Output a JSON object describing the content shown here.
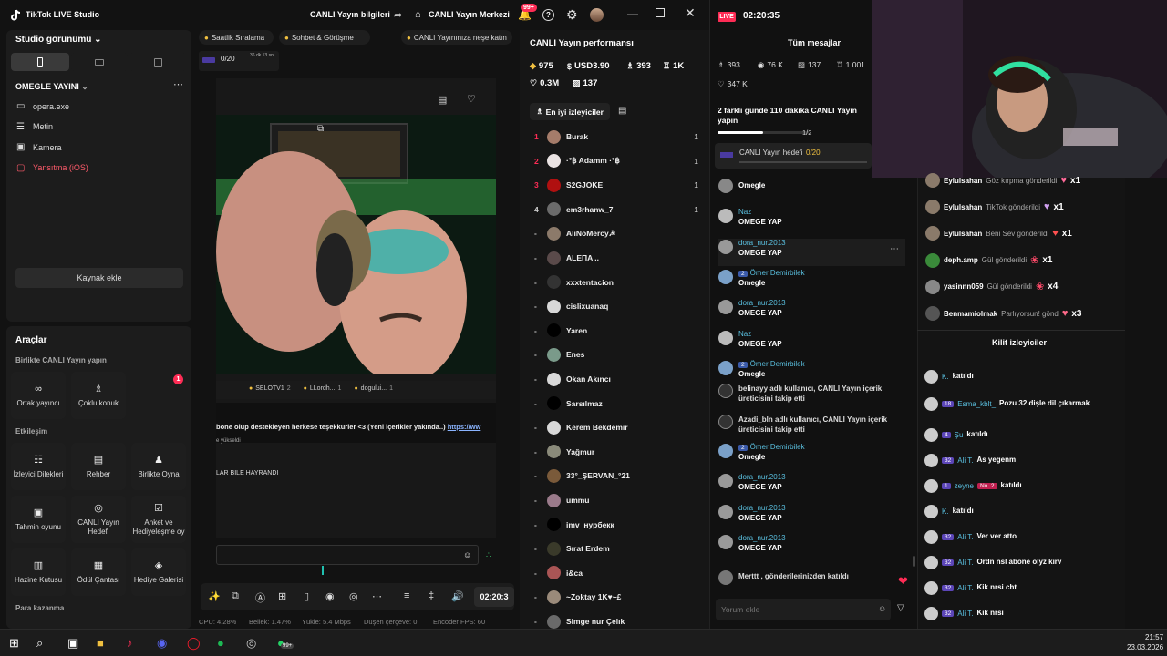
{
  "app": {
    "title": "TikTok LIVE Studio"
  },
  "titlebar": {
    "live_info": "CANLI Yayın bilgileri",
    "live_center": "CANLI Yayın Merkezi",
    "notif_badge": "99+"
  },
  "left": {
    "studio_view": "Studio görünümü",
    "scene_name": "OMEGLE YAYINI",
    "sources": [
      {
        "label": "opera.exe",
        "icon": "window-icon"
      },
      {
        "label": "Metin",
        "icon": "text-icon"
      },
      {
        "label": "Kamera",
        "icon": "camera-icon"
      },
      {
        "label": "Yansıtma (iOS)",
        "icon": "mirror-icon"
      }
    ],
    "add_source": "Kaynak ekle",
    "tools_title": "Araçlar",
    "section_together": "Birlikte CANLI Yayın yapın",
    "tools_together": [
      {
        "label": "Ortak yayıncı",
        "icon": "link-icon"
      },
      {
        "label": "Çoklu konuk",
        "icon": "users-icon",
        "badge": "1"
      }
    ],
    "section_engage": "Etkileşim",
    "tools_engage": [
      {
        "label": "İzleyici Dilekleri",
        "icon": "wish-icon"
      },
      {
        "label": "Rehber",
        "icon": "book-icon"
      },
      {
        "label": "Birlikte Oyna",
        "icon": "game-icon"
      },
      {
        "label": "Tahmin oyunu",
        "icon": "predict-icon"
      },
      {
        "label": "CANLI Yayın Hedefi",
        "icon": "target-icon"
      },
      {
        "label": "Anket ve Hediyeleşme oy",
        "icon": "poll-icon"
      },
      {
        "label": "Hazine Kutusu",
        "icon": "chest-icon"
      },
      {
        "label": "Ödül Çantası",
        "icon": "bag-icon"
      },
      {
        "label": "Hediye Galerisi",
        "icon": "gift-icon"
      }
    ],
    "section_money": "Para kazanma"
  },
  "center": {
    "pills": [
      "Saatlik Sıralama",
      "Sohbet & Görüşme",
      "CANLI Yayınınıza neşe katın"
    ],
    "goal_mini": "0/20",
    "goal_mini_time": "36 dk 13 sn",
    "banner_users": [
      {
        "name": "SELOTV1",
        "n": "2"
      },
      {
        "name": "LLordh...",
        "n": "1"
      },
      {
        "name": "dogului...",
        "n": "1"
      }
    ],
    "ticker_line1": "bone olup destekleyen herkese teşekkürler <3 (Yeni içerikler yakında..)",
    "ticker_link": "https://ww",
    "ticker_line2": "e yükseldi",
    "ticker_line3": "LAR BILE HAYRANDI",
    "timer": "02:20:3",
    "status": [
      {
        "label": "CPU:",
        "value": "4.28%"
      },
      {
        "label": "Bellek:",
        "value": "1.47%"
      },
      {
        "label": "Yükle:",
        "value": "5.4 Mbps"
      },
      {
        "label": "Düşen çerçeve:",
        "value": "0"
      },
      {
        "label": "Encoder FPS:",
        "value": "60"
      }
    ]
  },
  "perf": {
    "title": "CANLI Yayın performansı",
    "stats": [
      {
        "icon": "coin-icon",
        "value": "975"
      },
      {
        "icon": "dollar-icon",
        "value": "USD3.90"
      },
      {
        "icon": "viewers-icon",
        "value": "393"
      },
      {
        "icon": "follow-icon",
        "value": "1K"
      },
      {
        "icon": "heart-icon",
        "value": "0.3M"
      },
      {
        "icon": "gift-icon",
        "value": "137"
      }
    ],
    "tab_label": "En iyi izleyiciler",
    "viewers": [
      {
        "rank": "1",
        "name": "Burak",
        "count": "1",
        "color": "#a57c6a"
      },
      {
        "rank": "2",
        "name": "·°฿ Adamm ·°฿",
        "count": "1",
        "color": "#e9e2e2"
      },
      {
        "rank": "3",
        "name": "S2GJOKE",
        "count": "1",
        "color": "#b01010"
      },
      {
        "rank": "4",
        "name": "em3rhanw_7",
        "count": "1",
        "color": "#6b6b6b"
      },
      {
        "rank": "-",
        "name": "AliNoMercy☭",
        "count": "",
        "color": "#8c7a6a"
      },
      {
        "rank": "-",
        "name": "ALEПA ..",
        "count": "",
        "color": "#5a4a4a"
      },
      {
        "rank": "-",
        "name": "xxxtentacion",
        "count": "",
        "color": "#333"
      },
      {
        "rank": "-",
        "name": "cislixuanaq",
        "count": "",
        "color": "#d8d8d8"
      },
      {
        "rank": "-",
        "name": "Yaren",
        "count": "",
        "color": "#000"
      },
      {
        "rank": "-",
        "name": "Enes",
        "count": "",
        "color": "#7a9a8a"
      },
      {
        "rank": "-",
        "name": "Okan Akıncı",
        "count": "",
        "color": "#d8d8d8"
      },
      {
        "rank": "-",
        "name": "Sarsılmaz",
        "count": "",
        "color": "#000"
      },
      {
        "rank": "-",
        "name": "Kerem Bekdemir",
        "count": "",
        "color": "#d8d8d8"
      },
      {
        "rank": "-",
        "name": "Yağmur",
        "count": "",
        "color": "#8a8a7a"
      },
      {
        "rank": "-",
        "name": "33°_ŞERVAN_°21",
        "count": "",
        "color": "#7a5a3a"
      },
      {
        "rank": "-",
        "name": "ummu",
        "count": "",
        "color": "#9a7a8a"
      },
      {
        "rank": "-",
        "name": "imv_нурбекк",
        "count": "",
        "color": "#000"
      },
      {
        "rank": "-",
        "name": "Sırat Erdem",
        "count": "",
        "color": "#3a3a2a"
      },
      {
        "rank": "-",
        "name": "i&ca",
        "count": "",
        "color": "#aa5555"
      },
      {
        "rank": "-",
        "name": "~Zoktay 1K♥~£",
        "count": "",
        "color": "#9a8a7a"
      },
      {
        "rank": "-",
        "name": "Simge nur Çelık",
        "count": "",
        "color": "#6a6a6a"
      }
    ]
  },
  "chat": {
    "live": "LIVE",
    "time": "02:20:35",
    "all_messages": "Tüm mesajlar",
    "stats": [
      {
        "icon": "viewers-icon",
        "value": "393"
      },
      {
        "icon": "eye-icon",
        "value": "76 K"
      },
      {
        "icon": "gift-icon",
        "value": "137"
      },
      {
        "icon": "follow-icon",
        "value": "1.001"
      },
      {
        "icon": "heart-icon",
        "value": "347 K"
      }
    ],
    "mission": "2 farklı günde 110 dakika CANLI Yayın yapın",
    "mission_progress": "1/2",
    "mission_fraction": 0.5,
    "goal_label": "CANLI Yayın hedefi",
    "goal_value": "0/20",
    "messages": [
      {
        "name": "",
        "text": "Omegle",
        "lvl": "",
        "color": "#888"
      },
      {
        "name": "Naz",
        "text": "OMEGE YAP",
        "lvl": "",
        "color": "#bbb"
      },
      {
        "name": "dora_nur.2013",
        "text": "OMEGE YAP",
        "lvl": "",
        "color": "#999",
        "highlight": true
      },
      {
        "name": "Ömer Demirbilek",
        "text": "Omegle",
        "lvl": "2",
        "color": "#7aa0c8"
      },
      {
        "name": "dora_nur.2013",
        "text": "OMEGE YAP",
        "lvl": "",
        "color": "#999"
      },
      {
        "name": "Naz",
        "text": "OMEGE YAP",
        "lvl": "",
        "color": "#bbb"
      },
      {
        "name": "Ömer Demirbilek",
        "text": "Omegle",
        "lvl": "2",
        "color": "#7aa0c8"
      }
    ],
    "follow_events": [
      {
        "text": "belinayy  adlı kullanıcı, CANLI Yayın içerik üreticisini takip etti"
      },
      {
        "text": "Azadi_bln  adlı kullanıcı, CANLI Yayın içerik üreticisini takip etti"
      }
    ],
    "messages2": [
      {
        "name": "Ömer Demirbilek",
        "text": "Omegle",
        "lvl": "2",
        "color": "#7aa0c8"
      },
      {
        "name": "dora_nur.2013",
        "text": "OMEGE YAP",
        "lvl": "",
        "color": "#999"
      },
      {
        "name": "dora_nur.2013",
        "text": "OMEGE YAP",
        "lvl": "",
        "color": "#999"
      },
      {
        "name": "dora_nur.2013",
        "text": "OMEGE YAP",
        "lvl": "",
        "color": "#999"
      }
    ],
    "join_event": "Merttt , gönderilerinizden katıldı",
    "input_placeholder": "Yorum ekle"
  },
  "gifts": {
    "rows": [
      {
        "name": "Eylulsahan",
        "text": "Göz kırpma gönderildi",
        "mult": "x1",
        "color": "#8a7a6a"
      },
      {
        "name": "Eylulsahan",
        "text": "TikTok gönderildi",
        "mult": "x1",
        "color": "#8a7a6a"
      },
      {
        "name": "Eylulsahan",
        "text": "Beni Sev gönderildi",
        "mult": "x1",
        "color": "#8a7a6a"
      },
      {
        "name": "deph.amp",
        "text": "Gül gönderildi",
        "mult": "x1",
        "color": "#3a8a3a"
      },
      {
        "name": "yasinnn059",
        "text": "Gül gönderildi",
        "mult": "x4",
        "color": "#888"
      },
      {
        "name": "Benmamiolmak",
        "text": "Parlıyorsun! gönd",
        "mult": "x3",
        "color": "#555"
      }
    ],
    "locked_title": "Kilit izleyiciler",
    "locked": [
      {
        "name": "K.",
        "text": "katıldı",
        "lvl": "",
        "extra": ""
      },
      {
        "name": "Esma_kblt_",
        "text": "Pozu 32 dişle dil çıkarmak",
        "lvl": "18",
        "extra": ""
      },
      {
        "name": "Şu",
        "text": "katıldı",
        "lvl": "4",
        "extra": ""
      },
      {
        "name": "Ali T.",
        "text": "As yegenm",
        "lvl": "32",
        "extra": ""
      },
      {
        "name": "zeyne",
        "text": "katıldı",
        "lvl": "1",
        "extra": "No. 2"
      },
      {
        "name": "K.",
        "text": "katıldı",
        "lvl": "",
        "extra": ""
      },
      {
        "name": "Ali T.",
        "text": "Ver ver atto",
        "lvl": "32",
        "extra": ""
      },
      {
        "name": "Ali T.",
        "text": "Ordn nsl abone olyz kirv",
        "lvl": "32",
        "extra": ""
      },
      {
        "name": "Ali T.",
        "text": "Kik nrsi cht",
        "lvl": "32",
        "extra": ""
      },
      {
        "name": "Ali T.",
        "text": "Kik nrsi",
        "lvl": "32",
        "extra": ""
      }
    ]
  },
  "taskbar": {
    "time": "21:57",
    "date": "23.03.2026",
    "badge": "99+"
  }
}
